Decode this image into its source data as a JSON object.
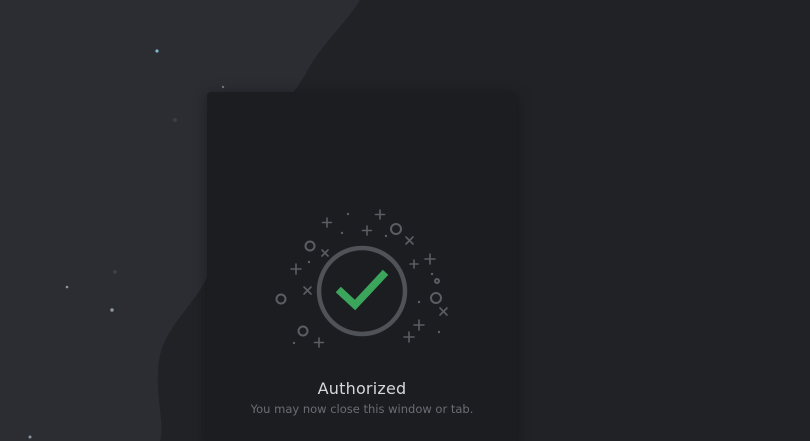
{
  "authorization": {
    "status_title": "Authorized",
    "status_message": "You may now close this window or tab."
  },
  "colors": {
    "background": "#202226",
    "blob": "#2b2d33",
    "modal": "#1c1d21",
    "check": "#3ba55c",
    "ring": "#4f5257"
  },
  "icons": {
    "status": "checkmark-icon"
  }
}
